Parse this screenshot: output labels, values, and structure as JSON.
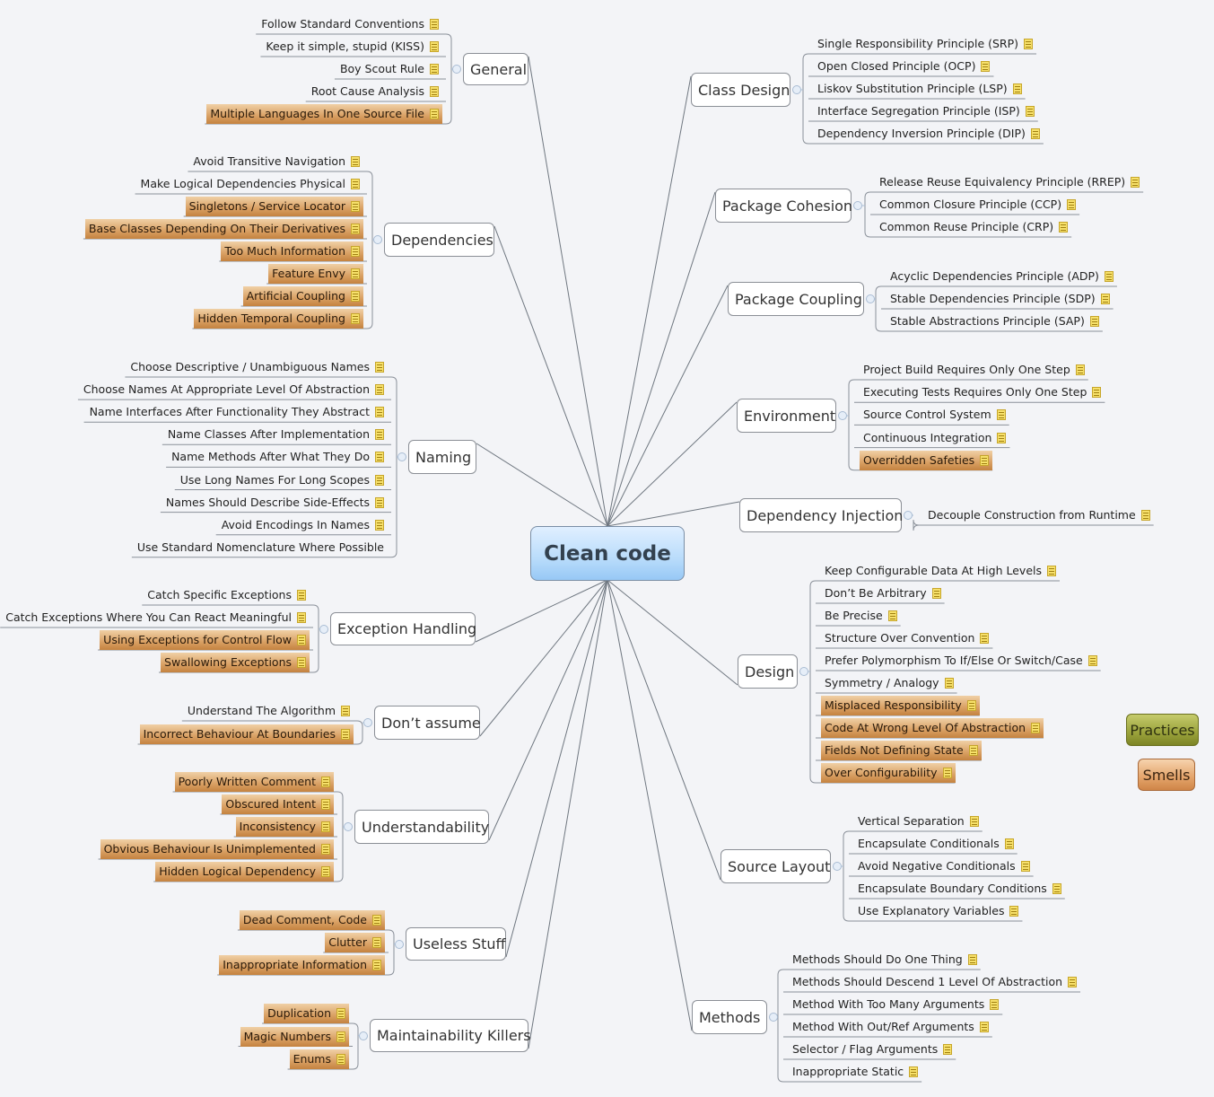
{
  "root": {
    "label": "Clean code"
  },
  "legend": {
    "practices": "Practices",
    "smells": "Smells"
  },
  "colors": {
    "practice_leaf": "#ffffff",
    "smell_leaf": "#d9a064",
    "root_fill": "#b9dcfb",
    "practices_legend": "#9aa23b",
    "smells_legend": "#e3a36a",
    "note_icon": "#f7e16b"
  },
  "branches": [
    {
      "id": "general",
      "label": "General",
      "side": "left",
      "children": [
        {
          "label": "Follow Standard Conventions",
          "type": "practice",
          "note": true
        },
        {
          "label": "Keep it simple, stupid (KISS)",
          "type": "practice",
          "note": true
        },
        {
          "label": "Boy Scout Rule",
          "type": "practice",
          "note": true
        },
        {
          "label": "Root Cause Analysis",
          "type": "practice",
          "note": true
        },
        {
          "label": "Multiple Languages In One Source File",
          "type": "smell",
          "note": true
        }
      ]
    },
    {
      "id": "dependencies",
      "label": "Dependencies",
      "side": "left",
      "children": [
        {
          "label": "Avoid Transitive Navigation",
          "type": "practice",
          "note": true
        },
        {
          "label": "Make Logical Dependencies Physical",
          "type": "practice",
          "note": true
        },
        {
          "label": "Singletons / Service Locator",
          "type": "smell",
          "note": true
        },
        {
          "label": "Base Classes Depending On Their Derivatives",
          "type": "smell",
          "note": true
        },
        {
          "label": "Too Much Information",
          "type": "smell",
          "note": true
        },
        {
          "label": "Feature Envy",
          "type": "smell",
          "note": true
        },
        {
          "label": "Artificial Coupling",
          "type": "smell",
          "note": true
        },
        {
          "label": "Hidden Temporal Coupling",
          "type": "smell",
          "note": true
        }
      ]
    },
    {
      "id": "naming",
      "label": "Naming",
      "side": "left",
      "children": [
        {
          "label": "Choose Descriptive / Unambiguous Names",
          "type": "practice",
          "note": true
        },
        {
          "label": "Choose Names At Appropriate Level Of Abstraction",
          "type": "practice",
          "note": true
        },
        {
          "label": "Name Interfaces After Functionality They Abstract",
          "type": "practice",
          "note": true
        },
        {
          "label": "Name Classes After Implementation",
          "type": "practice",
          "note": true
        },
        {
          "label": "Name Methods After What They Do",
          "type": "practice",
          "note": true
        },
        {
          "label": "Use Long Names For Long Scopes",
          "type": "practice",
          "note": true
        },
        {
          "label": "Names Should Describe Side-Effects",
          "type": "practice",
          "note": true
        },
        {
          "label": "Avoid Encodings In Names",
          "type": "practice",
          "note": true
        },
        {
          "label": "Use Standard Nomenclature Where Possible",
          "type": "practice",
          "note": false
        }
      ]
    },
    {
      "id": "exception-handling",
      "label": "Exception Handling",
      "side": "left",
      "children": [
        {
          "label": "Catch Specific Exceptions",
          "type": "practice",
          "note": true
        },
        {
          "label": "Catch Exceptions Where You Can React Meaningful",
          "type": "practice",
          "note": true
        },
        {
          "label": "Using Exceptions for Control Flow",
          "type": "smell",
          "note": true
        },
        {
          "label": "Swallowing Exceptions",
          "type": "smell",
          "note": true
        }
      ]
    },
    {
      "id": "dont-assume",
      "label": "Don’t assume",
      "side": "left",
      "children": [
        {
          "label": "Understand The Algorithm",
          "type": "practice",
          "note": true
        },
        {
          "label": "Incorrect Behaviour At Boundaries",
          "type": "smell",
          "note": true
        }
      ]
    },
    {
      "id": "understandability",
      "label": "Understandability",
      "side": "left",
      "children": [
        {
          "label": "Poorly Written Comment",
          "type": "smell",
          "note": true
        },
        {
          "label": "Obscured Intent",
          "type": "smell",
          "note": true
        },
        {
          "label": "Inconsistency",
          "type": "smell",
          "note": true
        },
        {
          "label": "Obvious Behaviour Is Unimplemented",
          "type": "smell",
          "note": true
        },
        {
          "label": "Hidden Logical Dependency",
          "type": "smell",
          "note": true
        }
      ]
    },
    {
      "id": "useless-stuff",
      "label": "Useless Stuff",
      "side": "left",
      "children": [
        {
          "label": "Dead Comment, Code",
          "type": "smell",
          "note": true
        },
        {
          "label": "Clutter",
          "type": "smell",
          "note": true
        },
        {
          "label": "Inappropriate Information",
          "type": "smell",
          "note": true
        }
      ]
    },
    {
      "id": "maintainability-killers",
      "label": "Maintainability Killers",
      "side": "left",
      "children": [
        {
          "label": "Duplication",
          "type": "smell",
          "note": true
        },
        {
          "label": "Magic Numbers",
          "type": "smell",
          "note": true
        },
        {
          "label": "Enums",
          "type": "smell",
          "note": true
        }
      ]
    },
    {
      "id": "class-design",
      "label": "Class Design",
      "side": "right",
      "children": [
        {
          "label": "Single Responsibility Principle (SRP)",
          "type": "practice",
          "note": true
        },
        {
          "label": "Open Closed Principle (OCP)",
          "type": "practice",
          "note": true
        },
        {
          "label": "Liskov Substitution Principle (LSP)",
          "type": "practice",
          "note": true
        },
        {
          "label": "Interface Segregation Principle (ISP)",
          "type": "practice",
          "note": true
        },
        {
          "label": "Dependency Inversion Principle (DIP)",
          "type": "practice",
          "note": true
        }
      ]
    },
    {
      "id": "package-cohesion",
      "label": "Package Cohesion",
      "side": "right",
      "children": [
        {
          "label": "Release Reuse Equivalency Principle (RREP)",
          "type": "practice",
          "note": true
        },
        {
          "label": "Common Closure Principle (CCP)",
          "type": "practice",
          "note": true
        },
        {
          "label": "Common Reuse Principle (CRP)",
          "type": "practice",
          "note": true
        }
      ]
    },
    {
      "id": "package-coupling",
      "label": "Package Coupling",
      "side": "right",
      "children": [
        {
          "label": "Acyclic Dependencies Principle (ADP)",
          "type": "practice",
          "note": true
        },
        {
          "label": "Stable Dependencies Principle (SDP)",
          "type": "practice",
          "note": true
        },
        {
          "label": "Stable Abstractions Principle (SAP)",
          "type": "practice",
          "note": true
        }
      ]
    },
    {
      "id": "environment",
      "label": "Environment",
      "side": "right",
      "children": [
        {
          "label": "Project Build Requires Only One Step",
          "type": "practice",
          "note": true
        },
        {
          "label": "Executing Tests Requires Only One Step",
          "type": "practice",
          "note": true
        },
        {
          "label": "Source Control System",
          "type": "practice",
          "note": true
        },
        {
          "label": "Continuous Integration",
          "type": "practice",
          "note": true
        },
        {
          "label": "Overridden Safeties",
          "type": "smell",
          "note": true
        }
      ]
    },
    {
      "id": "dependency-injection",
      "label": "Dependency Injection",
      "side": "right",
      "children": [
        {
          "label": "Decouple Construction from Runtime",
          "type": "practice",
          "note": true
        }
      ]
    },
    {
      "id": "design",
      "label": "Design",
      "side": "right",
      "children": [
        {
          "label": "Keep Configurable Data At High Levels",
          "type": "practice",
          "note": true
        },
        {
          "label": "Don’t Be Arbitrary",
          "type": "practice",
          "note": true
        },
        {
          "label": "Be Precise",
          "type": "practice",
          "note": true
        },
        {
          "label": "Structure Over Convention",
          "type": "practice",
          "note": true
        },
        {
          "label": "Prefer Polymorphism To If/Else Or Switch/Case",
          "type": "practice",
          "note": true
        },
        {
          "label": "Symmetry / Analogy",
          "type": "practice",
          "note": true
        },
        {
          "label": "Misplaced Responsibility",
          "type": "smell",
          "note": true
        },
        {
          "label": "Code At Wrong Level Of Abstraction",
          "type": "smell",
          "note": true
        },
        {
          "label": "Fields Not Defining State",
          "type": "smell",
          "note": true
        },
        {
          "label": "Over Configurability",
          "type": "smell",
          "note": true
        }
      ]
    },
    {
      "id": "source-layout",
      "label": "Source Layout",
      "side": "right",
      "children": [
        {
          "label": "Vertical Separation",
          "type": "practice",
          "note": true
        },
        {
          "label": "Encapsulate Conditionals",
          "type": "practice",
          "note": true
        },
        {
          "label": "Avoid Negative Conditionals",
          "type": "practice",
          "note": true
        },
        {
          "label": "Encapsulate Boundary Conditions",
          "type": "practice",
          "note": true
        },
        {
          "label": "Use Explanatory Variables",
          "type": "practice",
          "note": true
        }
      ]
    },
    {
      "id": "methods",
      "label": "Methods",
      "side": "right",
      "children": [
        {
          "label": "Methods Should Do One Thing",
          "type": "practice",
          "note": true
        },
        {
          "label": "Methods Should Descend 1 Level Of Abstraction",
          "type": "practice",
          "note": true
        },
        {
          "label": "Method With Too Many Arguments",
          "type": "practice",
          "note": true
        },
        {
          "label": "Method With Out/Ref Arguments",
          "type": "practice",
          "note": true
        },
        {
          "label": "Selector / Flag Arguments",
          "type": "practice",
          "note": true
        },
        {
          "label": "Inappropriate Static",
          "type": "practice",
          "note": true
        }
      ]
    }
  ]
}
